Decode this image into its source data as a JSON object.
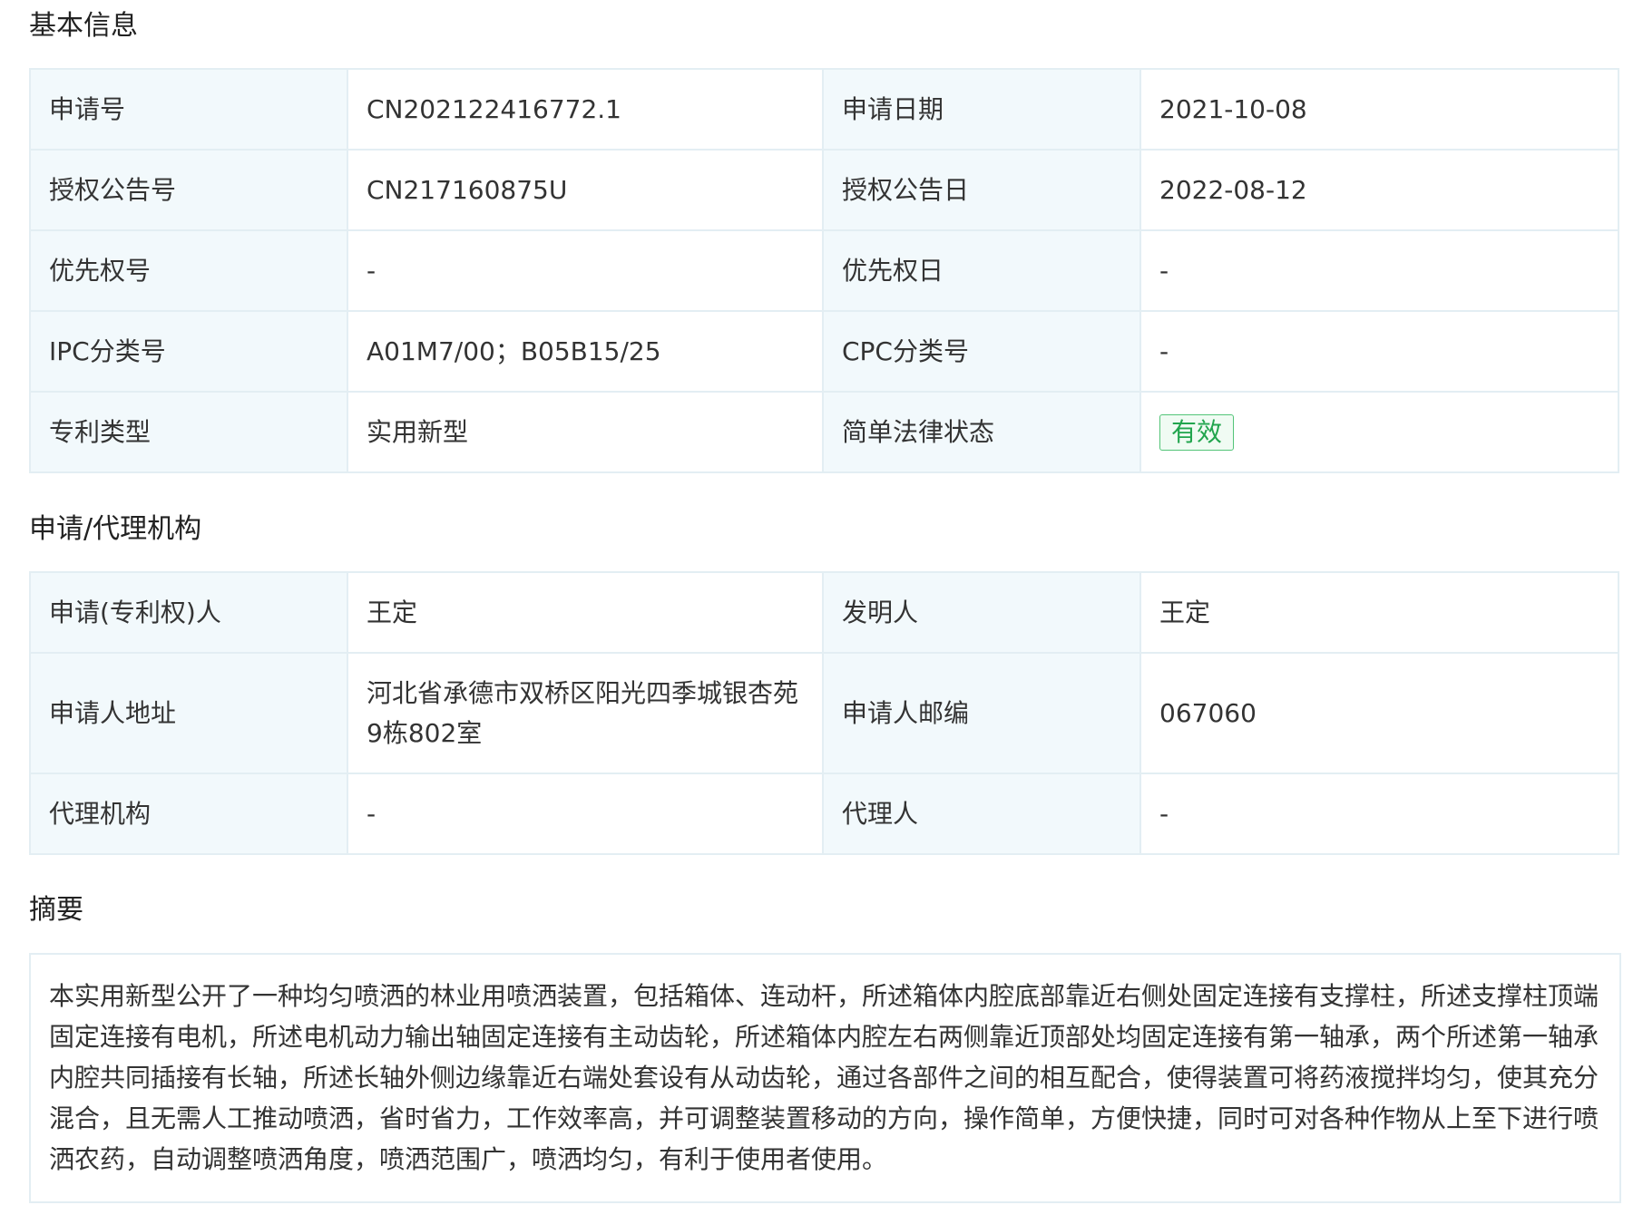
{
  "sections": {
    "basic_title": "基本信息",
    "agency_title": "申请/代理机构",
    "abstract_title": "摘要"
  },
  "basic": {
    "rows": [
      {
        "l1": "申请号",
        "v1": "CN202122416772.1",
        "l2": "申请日期",
        "v2": "2021-10-08"
      },
      {
        "l1": "授权公告号",
        "v1": "CN217160875U",
        "l2": "授权公告日",
        "v2": "2022-08-12"
      },
      {
        "l1": "优先权号",
        "v1": "-",
        "l2": "优先权日",
        "v2": "-"
      },
      {
        "l1": "IPC分类号",
        "v1": "A01M7/00；B05B15/25",
        "l2": "CPC分类号",
        "v2": "-"
      },
      {
        "l1": "专利类型",
        "v1": "实用新型",
        "l2": "简单法律状态",
        "v2": "有效"
      }
    ]
  },
  "agency": {
    "rows": [
      {
        "l1": "申请(专利权)人",
        "v1": "王定",
        "l2": "发明人",
        "v2": "王定"
      },
      {
        "l1": "申请人地址",
        "v1": "河北省承德市双桥区阳光四季城银杏苑9栋802室",
        "l2": "申请人邮编",
        "v2": "067060"
      },
      {
        "l1": "代理机构",
        "v1": "-",
        "l2": "代理人",
        "v2": "-"
      }
    ]
  },
  "abstract": {
    "text": "本实用新型公开了一种均匀喷洒的林业用喷洒装置，包括箱体、连动杆，所述箱体内腔底部靠近右侧处固定连接有支撑柱，所述支撑柱顶端固定连接有电机，所述电机动力输出轴固定连接有主动齿轮，所述箱体内腔左右两侧靠近顶部处均固定连接有第一轴承，两个所述第一轴承内腔共同插接有长轴，所述长轴外侧边缘靠近右端处套设有从动齿轮，通过各部件之间的相互配合，使得装置可将药液搅拌均匀，使其充分混合，且无需人工推动喷洒，省时省力，工作效率高，并可调整装置移动的方向，操作简单，方便快捷，同时可对各种作物从上至下进行喷洒农药，自动调整喷洒角度，喷洒范围广，喷洒均匀，有利于使用者使用。"
  },
  "colors": {
    "label_bg": "#f2f9fc",
    "border": "#e3eef3",
    "status_green": "#22a54e"
  }
}
